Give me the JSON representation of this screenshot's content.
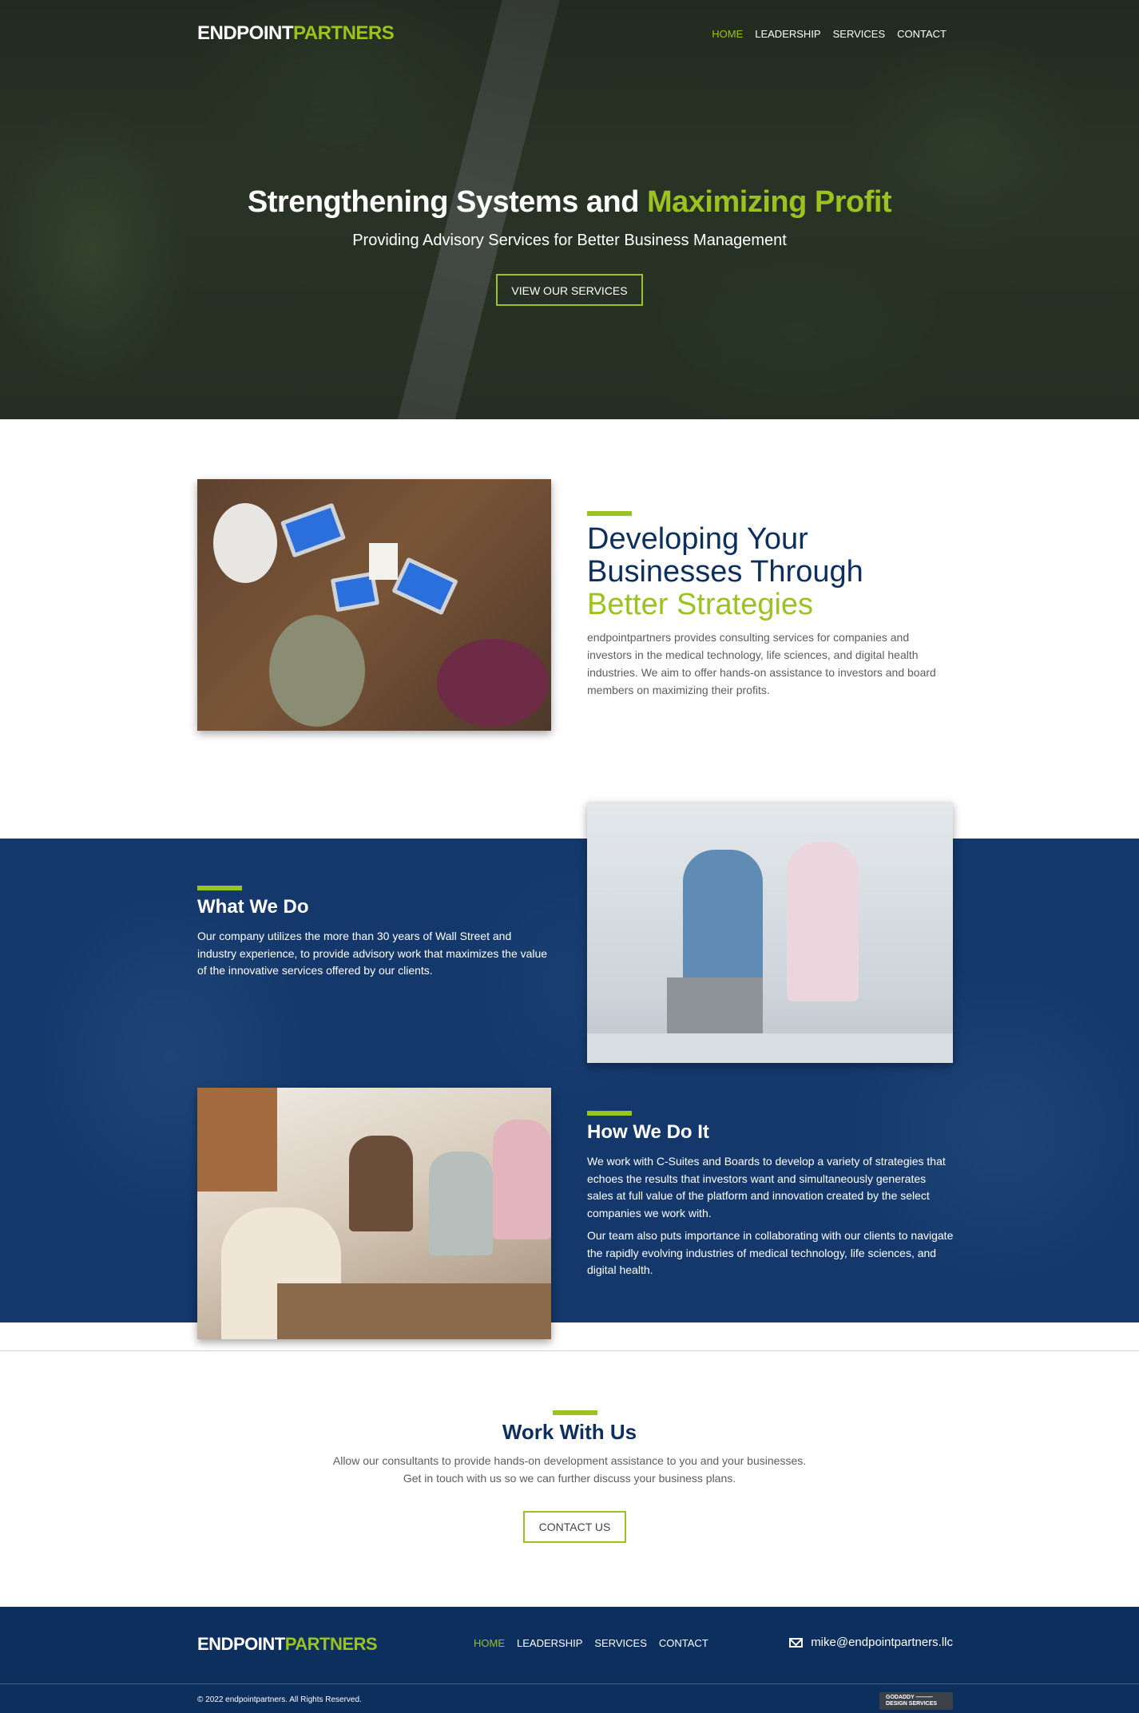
{
  "brand": {
    "logo_part1": "ENDPOINT",
    "logo_part2": "PARTNERS",
    "accent_color": "#9bc31f",
    "navy_color": "#0d2f5e"
  },
  "nav": [
    {
      "label": "HOME",
      "active": true
    },
    {
      "label": "LEADERSHIP",
      "active": false
    },
    {
      "label": "SERVICES",
      "active": false
    },
    {
      "label": "CONTACT",
      "active": false
    }
  ],
  "hero": {
    "title_part1": "Strengthening Systems and ",
    "title_part2": "Maximizing Profit",
    "subtitle": "Providing Advisory Services for Better Business Management",
    "button_label": "VIEW OUR SERVICES"
  },
  "developing": {
    "title_line1": "Developing Your",
    "title_line2": "Businesses Through",
    "title_line3": "Better Strategies",
    "text": "endpointpartners provides consulting services for companies and investors in the medical technology, life sciences, and digital health industries. We aim to offer hands-on assistance to investors and board members on maximizing their profits."
  },
  "what_we_do": {
    "title": "What We Do",
    "text": "Our company utilizes the more than 30 years of Wall Street and industry experience, to provide advisory work that maximizes the value of the innovative services offered by our clients."
  },
  "how_we_do_it": {
    "title": "How We Do It",
    "text1": "We work with C-Suites and Boards to develop a variety of strategies that echoes the results that investors want and simultaneously generates sales at full value of the platform and innovation created by the select companies we work with.",
    "text2": "Our team also puts importance in collaborating with our clients to navigate the rapidly evolving industries of medical technology, life sciences, and digital health."
  },
  "work": {
    "title": "Work With Us",
    "text": "Allow our consultants to provide hands-on development assistance to you and your businesses. Get in touch with us so we can further discuss your business plans.",
    "button_label": "CONTACT US"
  },
  "footer": {
    "email": "mike@endpointpartners.llc",
    "copyright": "© 2022 endpointpartners. All Rights Reserved.",
    "badge_line1": "GODADDY ———",
    "badge_line2": "DESIGN SERVICES"
  }
}
